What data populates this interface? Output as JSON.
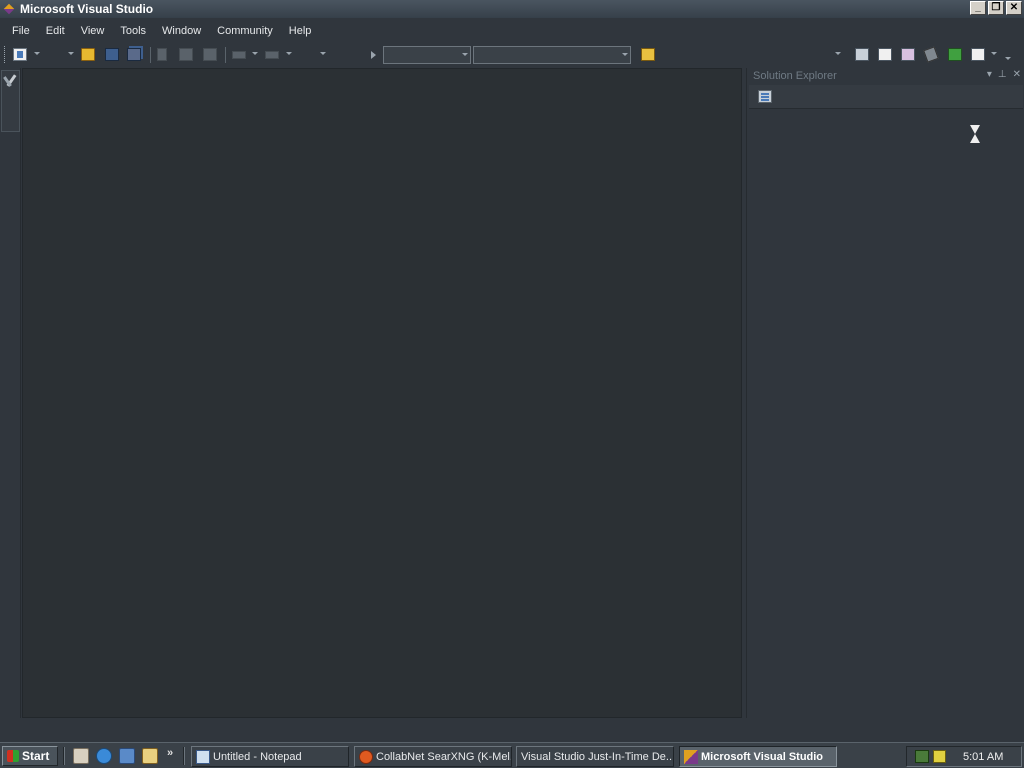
{
  "window": {
    "title": "Microsoft Visual Studio",
    "controls": {
      "minimize": "_",
      "restore": "❐",
      "close": "✕"
    }
  },
  "menubar": {
    "items": [
      "File",
      "Edit",
      "View",
      "Tools",
      "Window",
      "Community",
      "Help"
    ]
  },
  "toolbar": {
    "solution_config_value": "",
    "solution_platform_value": ""
  },
  "toolbox": {
    "icon": "toolbox-icon"
  },
  "solution_explorer": {
    "title": "Solution Explorer",
    "header_buttons": {
      "dropdown": "▾",
      "pin": "⊥",
      "close": "✕"
    }
  },
  "cursor": {
    "type": "hourglass"
  },
  "taskbar": {
    "start_label": "Start",
    "quicklaunch_more": "»",
    "tasks": [
      {
        "label": "Untitled - Notepad",
        "icon": "notepad-icon",
        "active": false
      },
      {
        "label": "CollabNet SearXNG (K-Mel...",
        "icon": "browser-icon",
        "active": false
      },
      {
        "label": "Visual Studio Just-In-Time De...",
        "icon": "",
        "active": false
      },
      {
        "label": "Microsoft Visual Studio",
        "icon": "vs-icon",
        "active": true
      }
    ],
    "clock": "5:01 AM"
  },
  "colors": {
    "background": "#30363d",
    "editor": "#2b3034",
    "titlebar": "#4a5560"
  }
}
